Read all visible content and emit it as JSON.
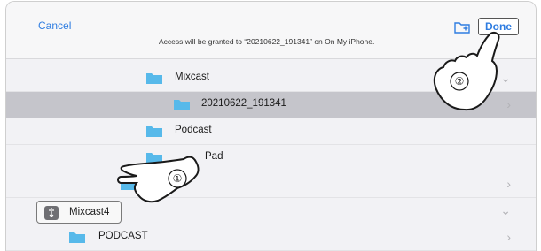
{
  "header": {
    "cancel_label": "Cancel",
    "banner_text": "Access will be granted to “20210622_191341” on On My iPhone.",
    "done_label": "Done"
  },
  "rows": [
    {
      "label": "Mixcast",
      "state": "expanded"
    },
    {
      "label": "20210622_191341",
      "state": "selected"
    },
    {
      "label": "Podcast",
      "state": "normal"
    },
    {
      "label": "Pad",
      "state": "normal"
    },
    {
      "label": "",
      "state": "normal"
    },
    {
      "label": "",
      "state": "normal"
    },
    {
      "label": "PODCAST",
      "state": "normal"
    }
  ],
  "device": {
    "label": "Mixcast4",
    "icon": "usb-drive-icon"
  },
  "callouts": {
    "step1": "①",
    "step2": "②"
  },
  "colors": {
    "accent": "#2f7de1",
    "folder": "#57b9ea",
    "selected_row": "#c5c5cb"
  }
}
